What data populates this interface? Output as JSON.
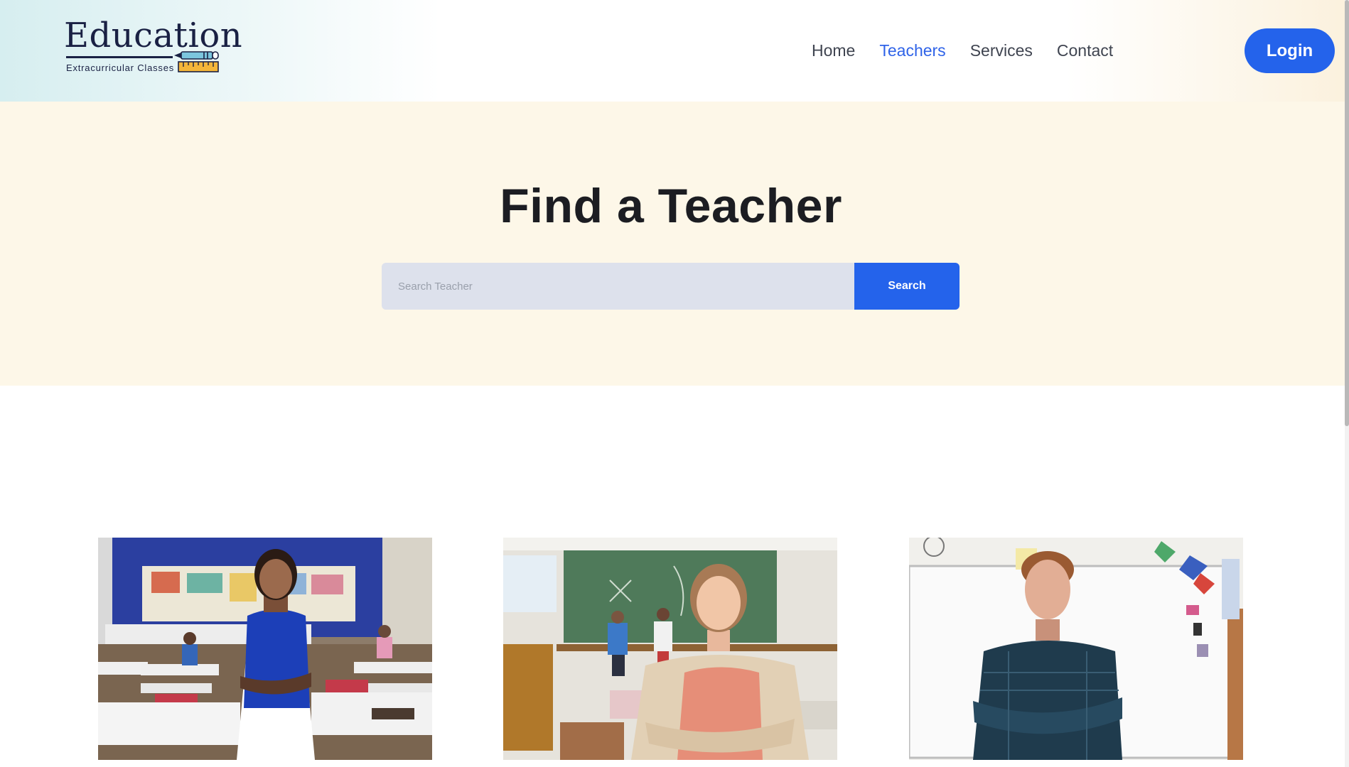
{
  "header": {
    "logo": {
      "title": "Education",
      "subtitle": "Extracurricular Classes"
    },
    "nav": [
      {
        "label": "Home",
        "active": false
      },
      {
        "label": "Teachers",
        "active": true
      },
      {
        "label": "Services",
        "active": false
      },
      {
        "label": "Contact",
        "active": false
      }
    ],
    "login_label": "Login"
  },
  "hero": {
    "title": "Find a Teacher",
    "search": {
      "placeholder": "Search Teacher",
      "value": "",
      "button_label": "Search"
    }
  },
  "teachers": [
    {
      "photo": "teacher-photo-woman-blue-shirt-classroom"
    },
    {
      "photo": "teacher-photo-woman-cardigan-chalkboard"
    },
    {
      "photo": "teacher-photo-man-plaid-shirt-whiteboard"
    }
  ],
  "colors": {
    "accent": "#2463eb",
    "nav_active": "#2f63e8",
    "hero_bg": "#fdf7e8",
    "search_bg": "#dde1ec",
    "logo_text": "#1a2144"
  }
}
